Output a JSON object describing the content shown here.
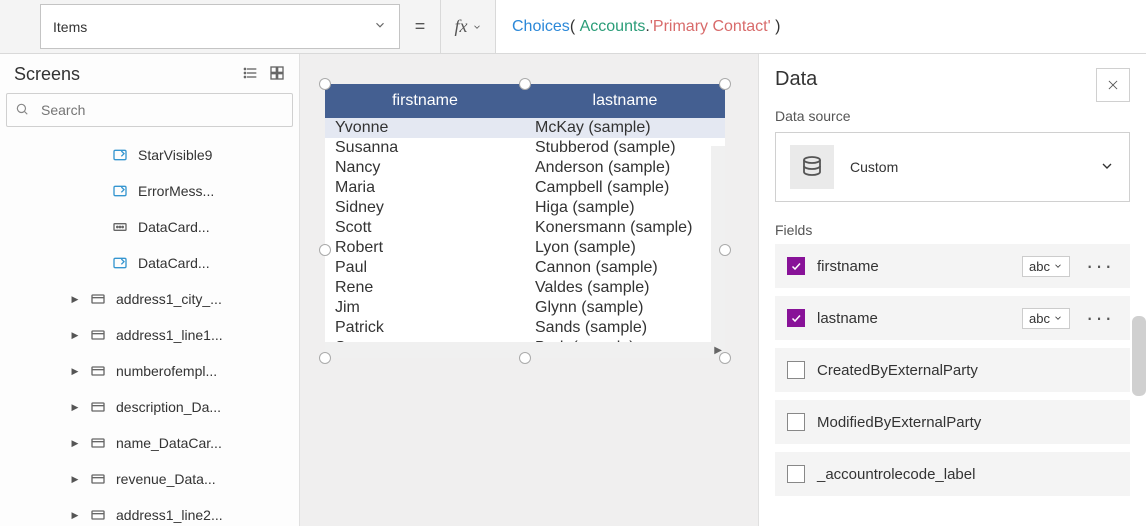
{
  "formula": {
    "property": "Items",
    "func": "Choices",
    "dataSource": "Accounts",
    "field": "'Primary Contact'"
  },
  "screensPanel": {
    "title": "Screens",
    "searchPlaceholder": "Search",
    "items": [
      {
        "icon": "rename",
        "label": "StarVisible9"
      },
      {
        "icon": "rename",
        "label": "ErrorMess..."
      },
      {
        "icon": "card",
        "label": "DataCard..."
      },
      {
        "icon": "rename",
        "label": "DataCard..."
      }
    ],
    "cards": [
      {
        "label": "address1_city_..."
      },
      {
        "label": "address1_line1..."
      },
      {
        "label": "numberofempl..."
      },
      {
        "label": "description_Da..."
      },
      {
        "label": "name_DataCar..."
      },
      {
        "label": "revenue_Data..."
      },
      {
        "label": "address1_line2..."
      }
    ]
  },
  "dataTable": {
    "headers": [
      "firstname",
      "lastname"
    ],
    "rows": [
      [
        "Yvonne",
        "McKay (sample)"
      ],
      [
        "Susanna",
        "Stubberod (sample)"
      ],
      [
        "Nancy",
        "Anderson (sample)"
      ],
      [
        "Maria",
        "Campbell (sample)"
      ],
      [
        "Sidney",
        "Higa (sample)"
      ],
      [
        "Scott",
        "Konersmann (sample)"
      ],
      [
        "Robert",
        "Lyon (sample)"
      ],
      [
        "Paul",
        "Cannon (sample)"
      ],
      [
        "Rene",
        "Valdes (sample)"
      ],
      [
        "Jim",
        "Glynn (sample)"
      ],
      [
        "Patrick",
        "Sands (sample)"
      ],
      [
        "Susan",
        "Burk (sample)"
      ]
    ]
  },
  "dataPanel": {
    "title": "Data",
    "dataSourceLabel": "Data source",
    "dataSourceName": "Custom",
    "fieldsLabel": "Fields",
    "fields": [
      {
        "checked": true,
        "name": "firstname",
        "type": "abc"
      },
      {
        "checked": true,
        "name": "lastname",
        "type": "abc"
      },
      {
        "checked": false,
        "name": "CreatedByExternalParty"
      },
      {
        "checked": false,
        "name": "ModifiedByExternalParty"
      },
      {
        "checked": false,
        "name": "_accountrolecode_label"
      }
    ]
  }
}
